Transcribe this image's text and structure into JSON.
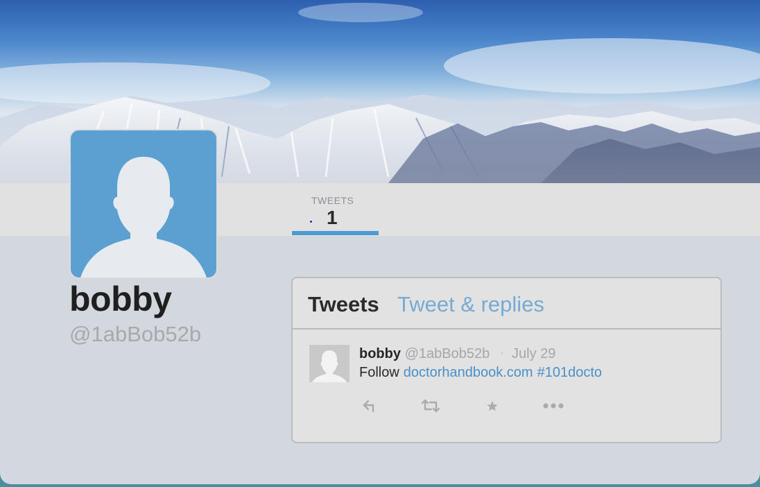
{
  "profile": {
    "display_name": "bobby",
    "screen_name": "@1abBob52b",
    "avatar_color": "#5ba0d0"
  },
  "stats": {
    "tweets_label": "TWEETS",
    "tweets_count": "1",
    "accent_color": "#4d9ad2"
  },
  "timeline": {
    "tabs": [
      {
        "label": "Tweets",
        "active": true
      },
      {
        "label": "Tweet & replies",
        "active": false
      }
    ],
    "tweets": [
      {
        "name": "bobby",
        "handle": "@1abBob52b",
        "separator": "·",
        "date": "July 29",
        "text_prefix": "Follow",
        "link": "doctorhandbook.com",
        "hashtag": "#101docto",
        "actions": [
          {
            "icon": "reply-icon"
          },
          {
            "icon": "retweet-icon"
          },
          {
            "icon": "favorite-star-icon"
          },
          {
            "icon": "more-icon"
          }
        ]
      }
    ]
  },
  "colors": {
    "link": "#4a90c8",
    "inactive_tab": "#76aad2",
    "muted_text": "#a4a6aa"
  }
}
